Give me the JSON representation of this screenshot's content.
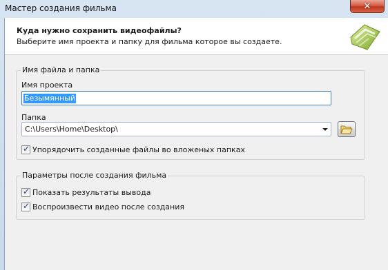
{
  "window": {
    "title": "Мастер создания фильма",
    "close_glyph": "✕"
  },
  "header": {
    "title": "Куда нужно сохранить видеофайлы?",
    "subtitle": "Выберите имя проекта и папку для фильма которое вы создаете.",
    "icon": "movie-wizard-icon"
  },
  "file_group": {
    "legend": "Имя файла и папка",
    "project_name_label": "Имя проекта",
    "project_name_value": "Безымянный",
    "folder_label": "Папка",
    "folder_value": "C:\\Users\\Home\\Desktop\\",
    "browse_icon": "folder-open-icon",
    "organize_checkbox_label": "Упорядочить созданные файлы во вложеных папках",
    "organize_checked": true
  },
  "after_group": {
    "legend": "Параметры после создания фильма",
    "show_results_label": "Показать результаты вывода",
    "show_results_checked": true,
    "play_video_label": "Воспроизвести видео после создания",
    "play_video_checked": true
  },
  "check_glyph": "✓"
}
